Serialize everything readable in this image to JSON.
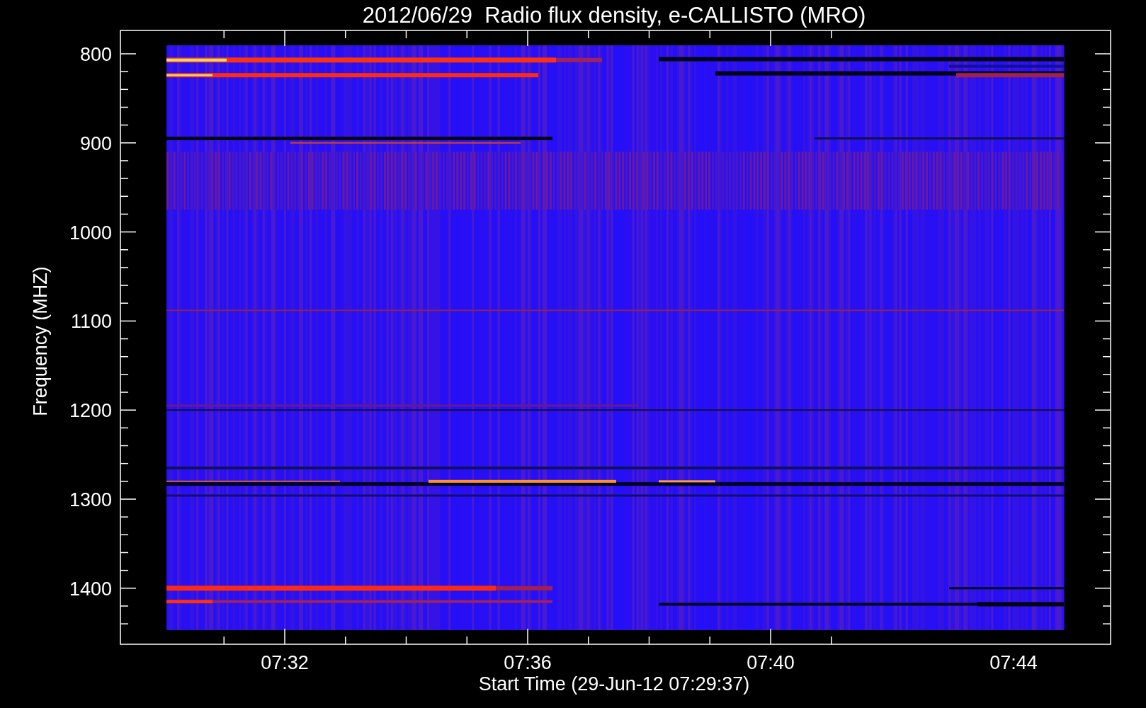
{
  "title": "2012/06/29  Radio flux density, e-CALLISTO (MRO)",
  "y_axis": {
    "label": "Frequency (MHZ)",
    "ticks": [
      "800",
      "900",
      "1000",
      "1100",
      "1200",
      "1300",
      "1400"
    ]
  },
  "x_axis": {
    "label": "Start Time (29-Jun-12 07:29:37)",
    "ticks": [
      "07:32",
      "07:36",
      "07:40",
      "07:44"
    ]
  }
}
